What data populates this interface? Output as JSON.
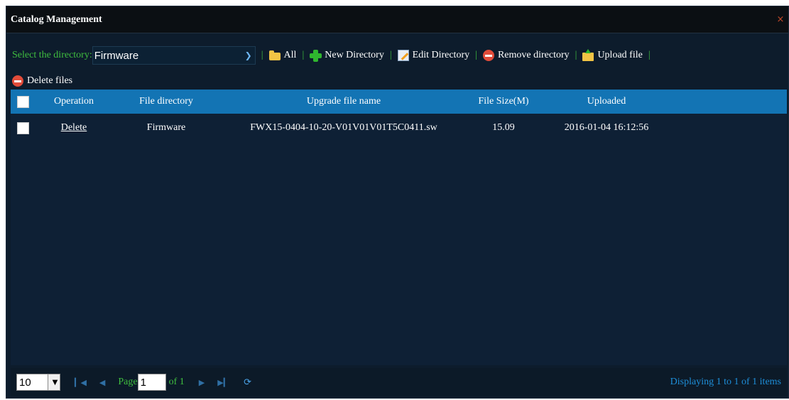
{
  "window": {
    "title": "Catalog Management",
    "close_glyph": "×"
  },
  "toolbar": {
    "select_label": "Select the directory:",
    "select_value": "Firmware",
    "separator": "|",
    "buttons": [
      {
        "label": "All",
        "icon": "folder-icon"
      },
      {
        "label": "New Directory",
        "icon": "plus-icon"
      },
      {
        "label": "Edit Directory",
        "icon": "edit-icon"
      },
      {
        "label": "Remove directory",
        "icon": "minus-circle-icon"
      },
      {
        "label": "Upload file",
        "icon": "upload-icon"
      }
    ],
    "delete_files": {
      "label": "Delete files",
      "icon": "minus-circle-icon"
    }
  },
  "grid": {
    "columns": [
      "Operation",
      "File directory",
      "Upgrade file name",
      "File Size(M)",
      "Uploaded"
    ],
    "rows": [
      {
        "operation": "Delete",
        "directory": "Firmware",
        "file_name": "FWX15-0404-10-20-V01V01V01T5C0411.sw",
        "size": "15.09",
        "uploaded": "2016-01-04 16:12:56"
      }
    ]
  },
  "pager": {
    "page_size": "10",
    "page_label": "Page",
    "page_value": "1",
    "of_label": "of 1",
    "status": "Displaying 1 to 1 of 1 items"
  },
  "colors": {
    "header_blue": "#1374b4",
    "label_green": "#3fbe3f",
    "status_blue": "#1e8ed8"
  }
}
